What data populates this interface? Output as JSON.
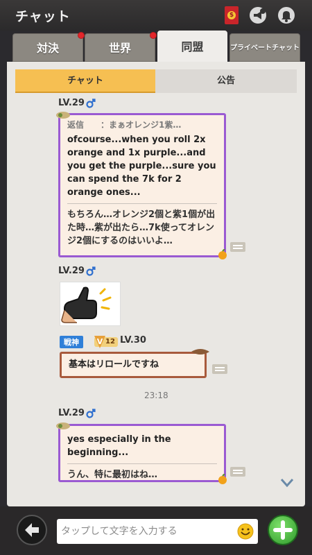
{
  "header": {
    "title": "チャット",
    "coupon_symbol": "$"
  },
  "tabs": [
    {
      "label": "対決",
      "has_dot": true
    },
    {
      "label": "世界",
      "has_dot": true
    },
    {
      "label": "同盟",
      "active": true
    },
    {
      "label": "プライベートチャット"
    }
  ],
  "subtabs": [
    {
      "label": "チャット",
      "active": true
    },
    {
      "label": "公告"
    }
  ],
  "messages": [
    {
      "level": "LV.29",
      "reply_label": "返信",
      "reply_text": "：まぁオレンジ1紫…",
      "text": "ofcourse...when you roll 2x orange and 1x purple...and you get the purple...sure you can spend the 7k for 2 orange ones...",
      "translation": "もちろん…オレンジ2個と紫1個が出た時…紫が出たら…7k使ってオレンジ2個にするのはいいよ…"
    },
    {
      "level": "LV.29",
      "sticker": "thumbs-up"
    },
    {
      "rank": "戦神",
      "vip": "12",
      "level": "LV.30",
      "text": "基本はリロールですね"
    },
    {
      "timestamp": "23:18"
    },
    {
      "level": "LV.29",
      "text": "yes especially in the beginning...",
      "translation": "うん、特に最初はね…"
    }
  ],
  "input": {
    "placeholder": "タップして文字を入力する"
  },
  "colors": {
    "accent": "#f6bf52",
    "purple_frame": "#9a5ad2",
    "male": "#2f6fce",
    "add_button": "#3fb13a"
  }
}
